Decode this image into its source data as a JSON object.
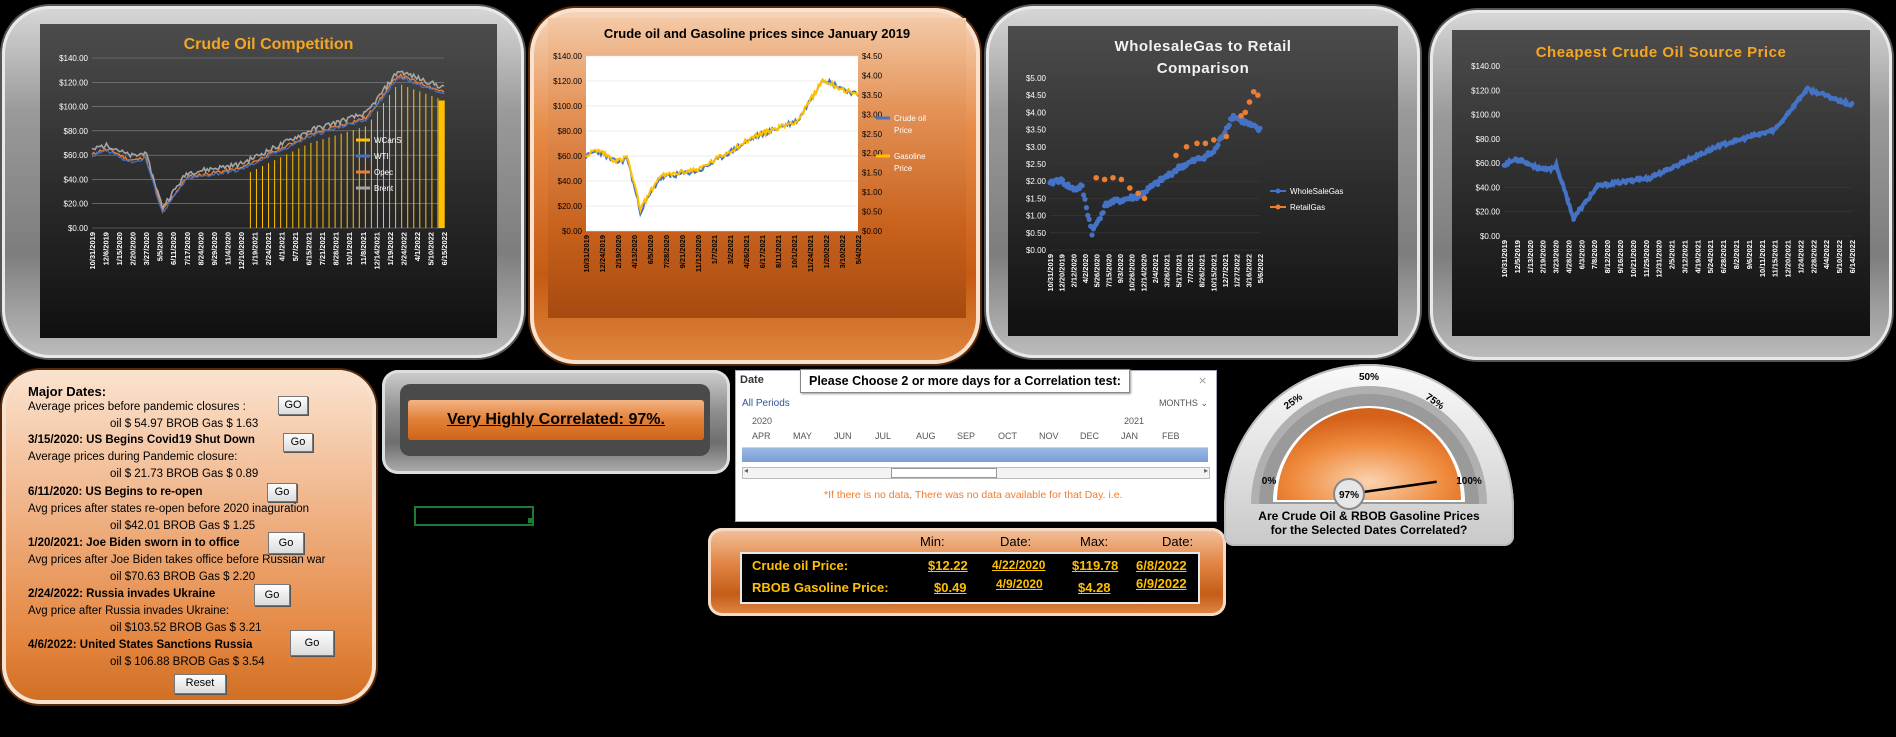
{
  "chart1": {
    "title": "Crude Oil Competition",
    "y_ticks": [
      "$140.00",
      "$120.00",
      "$100.00",
      "$80.00",
      "$60.00",
      "$40.00",
      "$20.00",
      "$0.00"
    ],
    "x_ticks": [
      "10/31/2019",
      "12/6/2019",
      "1/15/2020",
      "2/20/2020",
      "3/27/2020",
      "5/5/2020",
      "6/11/2020",
      "7/17/2020",
      "8/24/2020",
      "9/29/2020",
      "11/4/2020",
      "12/10/2020",
      "1/19/2021",
      "2/24/2021",
      "4/1/2021",
      "5/7/2021",
      "6/15/2021",
      "7/21/2021",
      "8/28/2021",
      "10/1/2021",
      "11/8/2021",
      "12/14/2021",
      "1/19/2022",
      "2/24/2022",
      "4/1/2022",
      "5/10/2022",
      "6/15/2022"
    ],
    "legend": [
      {
        "name": "WCanS",
        "color": "#ffc000"
      },
      {
        "name": "WTI",
        "color": "#4472c4"
      },
      {
        "name": "Opec",
        "color": "#ed7d31"
      },
      {
        "name": "Brent",
        "color": "#a5a5a5"
      }
    ]
  },
  "chart2": {
    "title": "Crude oil and Gasoline prices since January 2019",
    "y_ticks": [
      "$140.00",
      "$120.00",
      "$100.00",
      "$80.00",
      "$60.00",
      "$40.00",
      "$20.00",
      "$0.00"
    ],
    "y2_ticks": [
      "$4.50",
      "$4.00",
      "$3.50",
      "$3.00",
      "$2.50",
      "$2.00",
      "$1.50",
      "$1.00",
      "$0.50",
      "$0.00"
    ],
    "x_ticks": [
      "10/31/2019",
      "12/24/2019",
      "2/19/2020",
      "4/13/2020",
      "6/5/2020",
      "7/28/2020",
      "9/21/2020",
      "11/12/2020",
      "1/7/2021",
      "3/2/2021",
      "4/26/2021",
      "6/17/2021",
      "8/11/2021",
      "10/1/2021",
      "11/24/2021",
      "1/20/2022",
      "3/10/2022",
      "5/4/2022"
    ],
    "legend": [
      {
        "name": "Crude oil Price",
        "color": "#4472c4"
      },
      {
        "name": "Gasoline Price",
        "color": "#ffc000"
      }
    ]
  },
  "chart3": {
    "title_line1": "WholesaleGas to Retail",
    "title_line2": "Comparison",
    "y_ticks": [
      "$5.00",
      "$4.50",
      "$4.00",
      "$3.50",
      "$3.00",
      "$2.50",
      "$2.00",
      "$1.50",
      "$1.00",
      "$0.50",
      "$0.00"
    ],
    "x_ticks": [
      "10/31/2019",
      "12/20/2019",
      "2/12/2020",
      "4/2/2020",
      "5/26/2020",
      "7/15/2020",
      "9/3/2020",
      "10/26/2020",
      "12/14/2020",
      "2/4/2021",
      "3/26/2021",
      "5/17/2021",
      "7/7/2021",
      "8/26/2021",
      "10/15/2021",
      "12/7/2021",
      "1/27/2022",
      "3/16/2022",
      "5/6/2022"
    ],
    "legend": [
      {
        "name": "WholeSaleGas",
        "color": "#4472c4"
      },
      {
        "name": "RetailGas",
        "color": "#ed7d31"
      }
    ]
  },
  "chart4": {
    "title": "Cheapest Crude Oil Source Price",
    "y_ticks": [
      "$140.00",
      "$120.00",
      "$100.00",
      "$80.00",
      "$60.00",
      "$40.00",
      "$20.00",
      "$0.00"
    ],
    "x_ticks": [
      "10/31/2019",
      "12/5/2019",
      "1/13/2020",
      "2/19/2020",
      "3/23/2020",
      "4/28/2020",
      "6/3/2020",
      "7/8/2020",
      "8/12/2020",
      "9/16/2020",
      "10/21/2020",
      "11/25/2020",
      "12/31/2020",
      "2/5/2021",
      "3/12/2021",
      "4/19/2021",
      "5/24/2021",
      "6/28/2021",
      "8/2/2021",
      "9/6/2021",
      "10/11/2021",
      "11/15/2021",
      "12/20/2021",
      "1/24/2022",
      "2/28/2022",
      "4/4/2022",
      "5/10/2022",
      "6/14/2022"
    ]
  },
  "major_dates": {
    "heading": "Major Dates:",
    "entries": [
      {
        "label": "Average prices before pandemic closures :",
        "values": "oil $ 54.97  BROB Gas  $ 1.63",
        "button": "GO"
      },
      {
        "label": "3/15/2020:  US  Begins Covid19 Shut Down",
        "sub": "Average prices during Pandemic closure:",
        "values": "oil $ 21.73 BROB Gas $ 0.89",
        "button": "Go"
      },
      {
        "label": "6/11/2020:  US Begins to re-open",
        "sub": "Avg prices after states re-open before 2020 inaguration",
        "values": "oil $42.01 BROB Gas  $ 1.25",
        "button": "Go"
      },
      {
        "label": "1/20/2021:  Joe Biden sworn in to office",
        "sub": "Avg prices after Joe Biden takes office before Russian war",
        "values": "oil $70.63 BROB Gas  $ 2.20",
        "button": "Go"
      },
      {
        "label": "2/24/2022:  Russia invades Ukraine",
        "sub": "Avg price after Russia invades Ukraine:",
        "values": "oil $103.52  BROB Gas  $ 3.21",
        "button": "Go"
      },
      {
        "label": "4/6/2022:    United States Sanctions Russia",
        "values": "oil  $ 106.88  BROB Gas  $ 3.54",
        "button": "Go"
      }
    ],
    "reset": "Reset"
  },
  "correlation": {
    "label": "Very Highly Correlated: 97%."
  },
  "timeline": {
    "header": "Date",
    "prompt": "Please Choose 2 or more days for a Correlation test:",
    "all_periods": "All Periods",
    "months": "MONTHS",
    "years": [
      "2020",
      "2021"
    ],
    "month_labels": [
      "APR",
      "MAY",
      "JUN",
      "JUL",
      "AUG",
      "SEP",
      "OCT",
      "NOV",
      "DEC",
      "JAN",
      "FEB"
    ],
    "note": "*If there is no data, There was no data available for that Day. i.e."
  },
  "stats": {
    "headers": [
      "Min:",
      "Date:",
      "Max:",
      "Date:"
    ],
    "rows": [
      {
        "label": "Crude oil Price:",
        "min": "$12.22",
        "min_date": "4/22/2020",
        "max": "$119.78",
        "max_date": "6/8/2022"
      },
      {
        "label": "RBOB Gasoline Price:",
        "min": "$0.49",
        "min_date": "4/9/2020",
        "max": "$4.28",
        "max_date": "6/9/2022"
      }
    ]
  },
  "gauge": {
    "ticks": [
      "0%",
      "25%",
      "50%",
      "75%",
      "100%"
    ],
    "value_label": "97%",
    "value": 0.97,
    "question_line1": "Are Crude Oil & RBOB Gasoline Prices",
    "question_line2": "for the Selected Dates Correlated?"
  },
  "colors": {
    "blue": "#4472c4",
    "orange": "#ed7d31",
    "gold": "#ffc000",
    "grey": "#a5a5a5"
  }
}
